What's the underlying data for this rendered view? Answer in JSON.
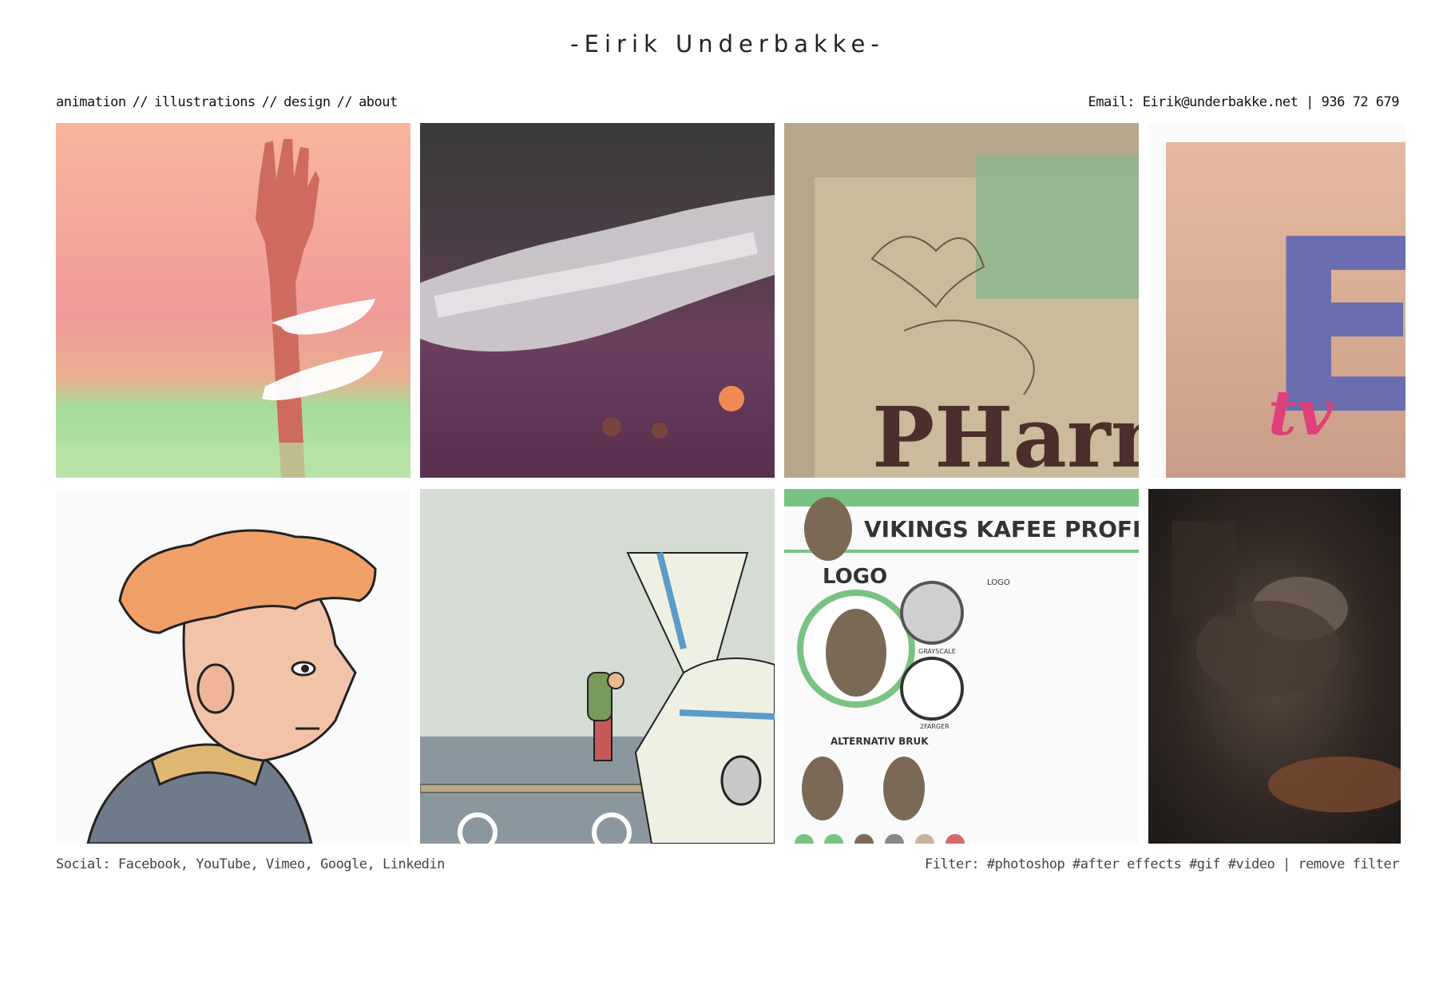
{
  "site": {
    "title": "-Eirik Underbakke-"
  },
  "nav": {
    "items": [
      {
        "label": "animation"
      },
      {
        "label": "illustrations"
      },
      {
        "label": "design"
      },
      {
        "label": "about"
      }
    ],
    "separator": "//"
  },
  "contact": {
    "label": "Email:",
    "email": "Eirik@underbakke.net",
    "divider": "|",
    "phone": "936 72 679"
  },
  "tiles": {
    "pharm_text": "PHarm",
    "etv_letter": "E",
    "etv_tv": "tv",
    "vikings_title": "VIKINGS KAFEE PROFIL",
    "vikings_logo": "LOGO",
    "vikings_logo_small": "LOGO",
    "vikings_grayscale": "GRAYSCALE",
    "vikings_2farger": "2FARGER",
    "vikings_alt": "ALTERNATIV BRUK"
  },
  "social": {
    "label": "Social:",
    "links": [
      "Facebook",
      "YouTube",
      "Vimeo",
      "Google",
      "Linkedin"
    ]
  },
  "filter": {
    "label": "Filter:",
    "tags": [
      "#photoshop",
      "#after effects",
      "#gif",
      "#video"
    ],
    "divider": "|",
    "remove": "remove filter"
  },
  "colors": {
    "background": "#ffffff",
    "text": "#111111",
    "muted_text": "#444444"
  }
}
